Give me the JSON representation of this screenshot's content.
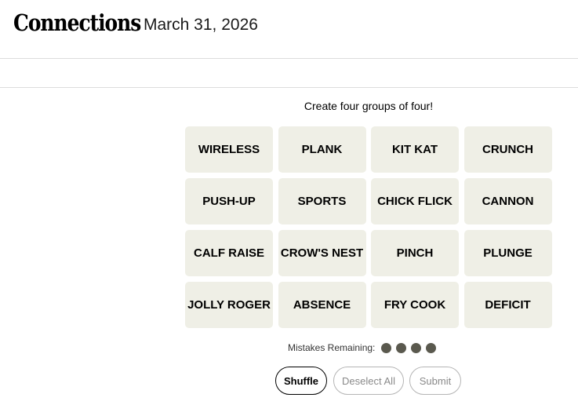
{
  "header": {
    "title": "Connections",
    "date": "March 31, 2026"
  },
  "game": {
    "instruction": "Create four groups of four!",
    "tiles": [
      "WIRELESS",
      "PLANK",
      "KIT KAT",
      "CRUNCH",
      "PUSH-UP",
      "SPORTS",
      "CHICK FLICK",
      "CANNON",
      "CALF RAISE",
      "CROW'S NEST",
      "PINCH",
      "PLUNGE",
      "JOLLY ROGER",
      "ABSENCE",
      "FRY COOK",
      "DEFICIT"
    ],
    "mistakes_label": "Mistakes Remaining:",
    "mistakes_remaining": 4
  },
  "buttons": {
    "shuffle": "Shuffle",
    "deselect_all": "Deselect All",
    "submit": "Submit"
  },
  "colors": {
    "tile_bg": "#efefe6",
    "dot": "#5a594e"
  }
}
